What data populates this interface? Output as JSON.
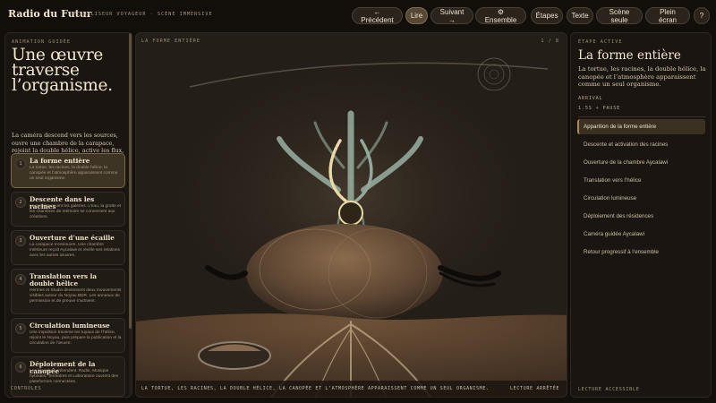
{
  "header": {
    "brand": "Radio du Futur",
    "subtitle": "VISUALISEUR VOYAGEUR · SCÈNE IMMERSIVE",
    "buttons": [
      {
        "label": "← Précédent"
      },
      {
        "label": "Lire"
      },
      {
        "label": "Suivant →"
      },
      {
        "label": "⚙ Ensemble"
      },
      {
        "label": "Étapes"
      },
      {
        "label": "Texte"
      },
      {
        "label": "Scène seule"
      },
      {
        "label": "Plein écran"
      },
      {
        "label": "?"
      }
    ]
  },
  "left": {
    "kicker": "ANIMATION GUIDÉE",
    "headline": "Une œuvre traverse l’organisme.",
    "intro": "La caméra descend vers les sources, ouvre une chambre de la carapace, rejoint la double hélice, active les flux, déploie la canopée et accompagne Aycalawi vers les publics.",
    "steps": [
      {
        "num": "1",
        "title": "La forme entière",
        "desc": "La tortue, les racines, la double hélice, la canopée et l’atmosphère apparaissent comme un seul organisme."
      },
      {
        "num": "2",
        "title": "Descente dans les racines",
        "desc": "La caméra rejoint les galeries. L’eau, la grotte et les chambres de mémoire se connectent aux créations."
      },
      {
        "num": "3",
        "title": "Ouverture d’une écaille",
        "desc": "La carapace s’entrouvre. Une chambre intérieure reçoit Aycalawi et révèle ses relations avec les autres œuvres."
      },
      {
        "num": "4",
        "title": "Translation vers la double hélice",
        "desc": "Hermes et Studio deviennent deux mouvements visibles autour du Noyau BDR. Les anneaux de permission et de preuve s’activent."
      },
      {
        "num": "5",
        "title": "Circulation lumineuse",
        "desc": "Une impulsion traverse les tuyaux de l’hélice, rejoint le Noyau, puis prépare la publication et la circulation de l’œuvre."
      },
      {
        "num": "6",
        "title": "Déploiement de la canopée",
        "desc": "Les branches s’étendent. Radio, Musique hybrides, Territoires et Laboratoire ouvrent des plateformes connectées."
      }
    ],
    "footer": "CONTROLES"
  },
  "stage": {
    "label": "LA FORME ENTIÈRE",
    "counter": "1 / 8",
    "caption": "LA TORTUE, LES RACINES, LA DOUBLE HÉLICE, LA CANOPÉE ET L’ATMOSPHÈRE APPARAISSENT COMME UN SEUL ORGANISME.",
    "status": "LECTURE ARRÊTÉE"
  },
  "right": {
    "kicker": "ÉTAPE ACTIVE",
    "title": "La forme entière",
    "desc": "La tortue, les racines, la double hélice, la canopée et l’atmosphère apparaissent comme un seul organisme.",
    "label": "ARRIVAL",
    "timing": "1.5S + PAUSE",
    "list": [
      "Apparition de la forme entière",
      "Descente et activation des racines",
      "Ouverture de la chambre Aycalawi",
      "Translation vers l’hélice",
      "Circulation lumineuse",
      "Déploiement des résidences",
      "Caméra guidée Aycalawi",
      "Retour progressif à l’ensemble"
    ],
    "footer": "LECTURE ACCESSIBLE"
  },
  "colors": {
    "background": "#120e0a",
    "panel": "#1a1510",
    "accent": "#a88d5a",
    "text": "#e8dcc4",
    "helix": "#98ad9f",
    "helix_glow": "#e8d9a6"
  }
}
